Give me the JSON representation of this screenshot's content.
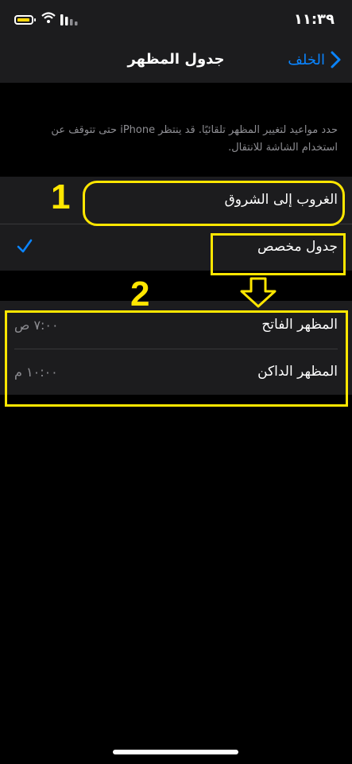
{
  "status_bar": {
    "time": "١١:٣٩"
  },
  "nav": {
    "title": "جدول المظهر",
    "back_label": "الخلف"
  },
  "description": "حدد مواعيد لتغيير المظهر تلقائيًا. قد ينتظر iPhone حتى تتوقف عن استخدام الشاشة للانتقال.",
  "schedule_options": [
    {
      "label": "الغروب إلى الشروق",
      "selected": false
    },
    {
      "label": "جدول مخصص",
      "selected": true
    }
  ],
  "custom_schedule": [
    {
      "label": "المظهر الفاتح",
      "value": "٧:٠٠ ص"
    },
    {
      "label": "المظهر الداكن",
      "value": "١٠:٠٠ م"
    }
  ],
  "annotations": {
    "step1": "1",
    "step2": "2"
  },
  "colors": {
    "accent": "#0a84ff",
    "highlight": "#ffe600",
    "background": "#000000",
    "cell": "#1c1c1e"
  }
}
